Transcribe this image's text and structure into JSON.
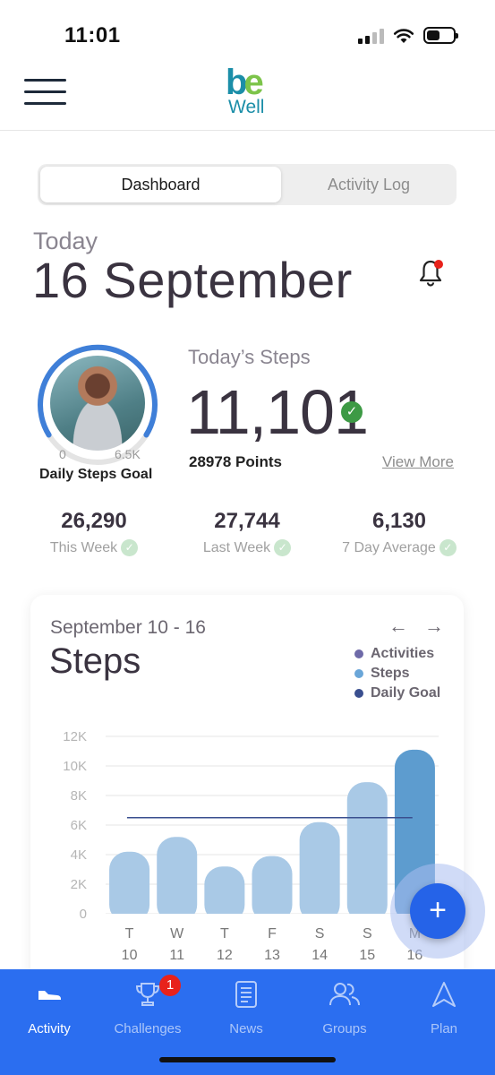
{
  "status": {
    "time": "11:01"
  },
  "header": {
    "logo_be_b": "b",
    "logo_be_e": "e",
    "logo_well": "Well"
  },
  "tabs": {
    "active": "Dashboard",
    "inactive": "Activity Log"
  },
  "date": {
    "label": "Today",
    "title": "16 September"
  },
  "steps": {
    "ring_min": "0",
    "ring_max": "6.5K",
    "ring_caption": "Daily Steps Goal",
    "label": "Today’s Steps",
    "value": "11,101",
    "points": "28978 Points",
    "view_more": "View More"
  },
  "stats": [
    {
      "value": "26,290",
      "label": "This Week"
    },
    {
      "value": "27,744",
      "label": "Last Week"
    },
    {
      "value": "6,130",
      "label": "7 Day Average"
    }
  ],
  "card": {
    "range": "September 10 - 16",
    "title": "Steps",
    "prev_arrow": "←",
    "next_arrow": "→",
    "legend": [
      {
        "label": "Activities",
        "color": "#6e6aa8"
      },
      {
        "label": "Steps",
        "color": "#6aa6d8"
      },
      {
        "label": "Daily Goal",
        "color": "#3a4f8f"
      }
    ]
  },
  "chart_data": {
    "type": "bar",
    "categories": [
      "T 10",
      "W 11",
      "T 12",
      "F 13",
      "S 14",
      "S 15",
      "M 16"
    ],
    "day_letters": [
      "T",
      "W",
      "T",
      "F",
      "S",
      "S",
      "M"
    ],
    "day_numbers": [
      "10",
      "11",
      "12",
      "13",
      "14",
      "15",
      "16"
    ],
    "series": [
      {
        "name": "Steps",
        "values": [
          4200,
          5200,
          3200,
          3900,
          6200,
          8900,
          11101
        ]
      }
    ],
    "goal": 6500,
    "ylim": [
      0,
      12000
    ],
    "yticks": [
      "0",
      "2K",
      "4K",
      "6K",
      "8K",
      "10K",
      "12K"
    ],
    "bar_colors": [
      "#a9c9e6",
      "#a9c9e6",
      "#a9c9e6",
      "#a9c9e6",
      "#a9c9e6",
      "#a9c9e6",
      "#5d9ccf"
    ],
    "grid": true
  },
  "fab": {
    "label": "+"
  },
  "nav": [
    {
      "label": "Activity",
      "icon": "shoe-icon",
      "active": true
    },
    {
      "label": "Challenges",
      "icon": "trophy-icon",
      "badge": "1"
    },
    {
      "label": "News",
      "icon": "document-icon"
    },
    {
      "label": "Groups",
      "icon": "people-icon"
    },
    {
      "label": "Plan",
      "icon": "navigation-icon"
    }
  ]
}
